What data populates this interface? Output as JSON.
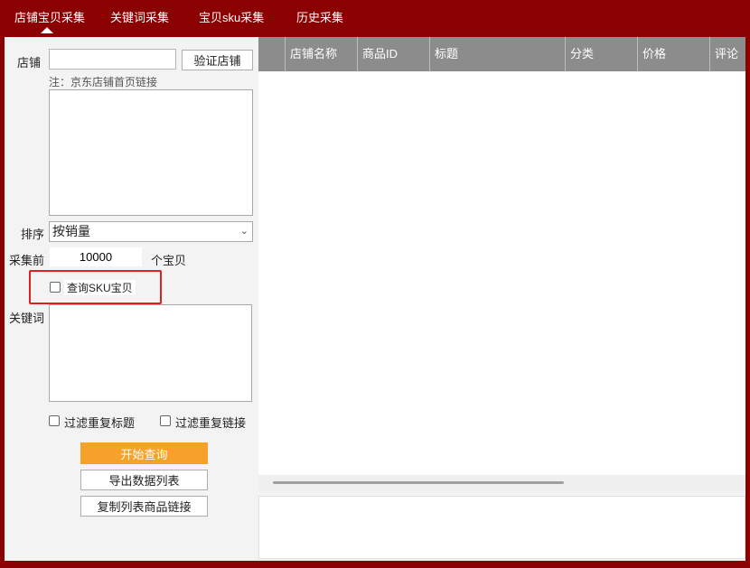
{
  "tabs": [
    {
      "label": "店铺宝贝采集",
      "active": true
    },
    {
      "label": "关键词采集",
      "active": false
    },
    {
      "label": "宝贝sku采集",
      "active": false
    },
    {
      "label": "历史采集",
      "active": false
    }
  ],
  "left": {
    "shop_label": "店铺",
    "shop_input_value": "",
    "verify_button": "验证店铺",
    "note": "注：京东店铺首页链接",
    "sort_label": "排序",
    "sort_value": "按销量",
    "collect_prefix": "采集前",
    "collect_count": "10000",
    "collect_suffix": "个宝贝",
    "query_sku_label": "查询SKU宝贝",
    "keyword_label": "关键词",
    "filter_title_label": "过滤重复标题",
    "filter_link_label": "过滤重复链接",
    "start_button": "开始查询",
    "export_button": "导出数据列表",
    "copy_button": "复制列表商品链接"
  },
  "grid": {
    "columns": [
      "",
      "店铺名称",
      "商品ID",
      "标题",
      "分类",
      "价格",
      "评论"
    ]
  },
  "colors": {
    "brand": "#8b0000",
    "primary_button": "#f5a12a",
    "header_bg": "#8c8c8c",
    "highlight": "#e02020"
  }
}
